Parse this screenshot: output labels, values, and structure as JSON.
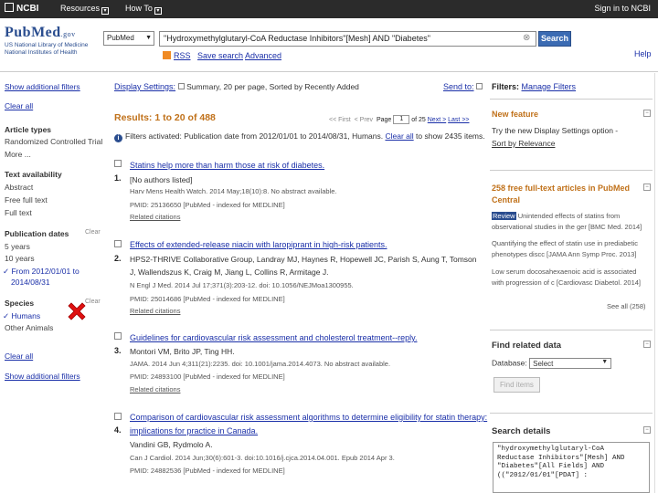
{
  "topbar": {
    "brand": "NCBI",
    "resources": "Resources",
    "howto": "How To",
    "signin": "Sign in to NCBI"
  },
  "header": {
    "logo": "PubMed",
    "logo_suffix": ".gov",
    "logo_sub1": "US National Library of Medicine",
    "logo_sub2": "National Institutes of Health",
    "db_value": "PubMed",
    "query": "\"Hydroxymethylglutaryl-CoA Reductase Inhibitors\"[Mesh] AND \"Diabetes\"",
    "search_label": "Search",
    "rss": "RSS",
    "save_search": "Save search",
    "advanced": "Advanced",
    "help": "Help"
  },
  "left": {
    "show_filters": "Show additional filters",
    "clear_all": "Clear all",
    "article_types_title": "Article types",
    "article_types": [
      "Randomized Controlled Trial",
      "More ..."
    ],
    "text_title": "Text availability",
    "text_items": [
      "Abstract",
      "Free full text",
      "Full text"
    ],
    "pubdates_title": "Publication dates",
    "pubdates_clear": "Clear",
    "pubdates_items": [
      "5 years",
      "10 years"
    ],
    "pubdates_selected": "From 2012/01/01 to",
    "pubdates_selected2": "2014/08/31",
    "species_title": "Species",
    "species_clear": "Clear",
    "species_selected": "Humans",
    "species_other": "Other Animals",
    "clear_all2": "Clear all",
    "show_filters2": "Show additional filters"
  },
  "main": {
    "display_settings": "Display Settings:",
    "display_summary": "Summary, 20 per page, Sorted by Recently Added",
    "send_to": "Send to:",
    "results_title": "Results: 1 to 20 of 488",
    "pager_first": "<< First",
    "pager_prev": "< Prev",
    "pager_page": "Page",
    "pager_current": "1",
    "pager_of": "of 25",
    "pager_next": "Next >",
    "pager_last": "Last >>",
    "filters_msg": "Filters activated: Publication date from 2012/01/01 to 2014/08/31, Humans.",
    "filters_clear": "Clear all",
    "filters_msg2": "to show 2435 items.",
    "results": [
      {
        "num": "1.",
        "title": "Statins help more than harm those at risk of diabetes.",
        "authors": "[No authors listed]",
        "journal": "Harv Mens Health Watch. 2014 May;18(10):8. No abstract available.",
        "pmid": "PMID: 25136650 [PubMed - indexed for MEDLINE]",
        "related": "Related citations"
      },
      {
        "num": "2.",
        "title": "Effects of extended-release niacin with laropiprant in high-risk patients.",
        "authors": "HPS2-THRIVE Collaborative Group, Landray MJ, Haynes R, Hopewell JC, Parish S, Aung T, Tomson",
        "authors2": "J, Wallendszus K, Craig M, Jiang L, Collins R, Armitage J.",
        "journal": "N Engl J Med. 2014 Jul 17;371(3):203-12. doi: 10.1056/NEJMoa1300955.",
        "pmid": "PMID: 25014686 [PubMed - indexed for MEDLINE]",
        "related": "Related citations"
      },
      {
        "num": "3.",
        "title": "Guidelines for cardiovascular risk assessment and cholesterol treatment--reply.",
        "authors": "Montori VM, Brito JP, Ting HH.",
        "journal": "JAMA. 2014 Jun 4;311(21):2235. doi: 10.1001/jama.2014.4073. No abstract available.",
        "pmid": "PMID: 24893100 [PubMed - indexed for MEDLINE]",
        "related": "Related citations"
      },
      {
        "num": "4.",
        "title": "Comparison of cardiovascular risk assessment algorithms to determine eligibility for statin therapy:",
        "title2": "implications for practice in Canada.",
        "authors": "Vandini GB, Rydmolo A.",
        "journal": "Can J Cardiol. 2014 Jun;30(6):601-3. doi:10.1016/j.cjca.2014.04.001. Epub 2014 Apr 3.",
        "pmid": "PMID: 24882536 [PubMed - indexed for MEDLINE]"
      }
    ]
  },
  "right": {
    "filters_title": "Filters:",
    "manage_filters": "Manage Filters",
    "new_feature_title": "New feature",
    "new_feature_text": "Try the new Display Settings option -",
    "new_feature_link": "Sort by Relevance",
    "free_title1": "258 free full-text articles in PubMed",
    "free_title2": "Central",
    "free_items": [
      {
        "tag": "Review",
        "l1": "Unintended effects of statins from",
        "l2": "observational studies in the ger [BMC Med. 2014]"
      },
      {
        "l1": "Quantifying the effect of statin use in prediabetic",
        "l2": "phenotypes discc [JAMA Ann Symp Proc. 2013]"
      },
      {
        "l1": "Low serum docosahexaenoic acid is associated",
        "l2": "with progression of c [Cardiovasc Diabetol. 2014]"
      }
    ],
    "see_all": "See all (258)",
    "find_related_title": "Find related data",
    "database_label": "Database:",
    "database_value": "Select",
    "find_items": "Find items",
    "search_details_title": "Search details",
    "search_details": "\"hydroxymethylglutaryl-CoA\nReductase Inhibitors\"[Mesh] AND\n\"Diabetes\"[All Fields] AND\n((\"2012/01/01\"[PDAT] :"
  }
}
